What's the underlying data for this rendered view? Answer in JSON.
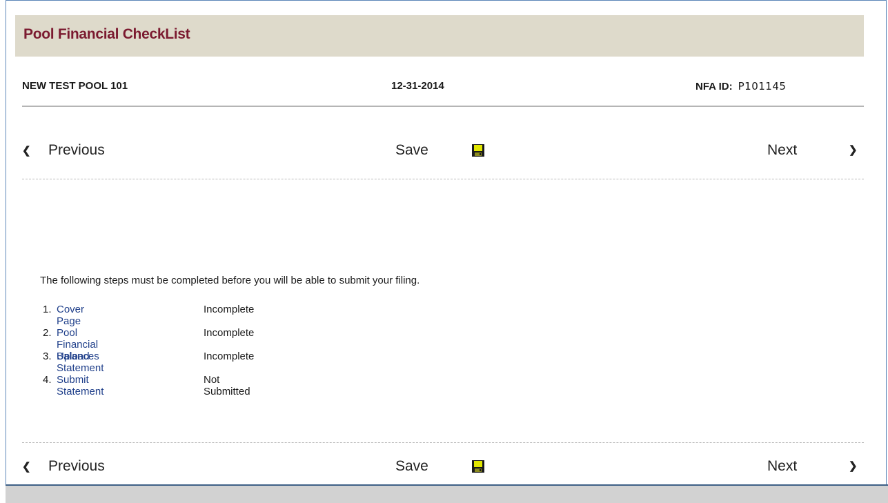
{
  "header": {
    "title": "Pool Financial CheckList"
  },
  "info": {
    "pool_name": "NEW TEST POOL 101",
    "period_date": "12-31-2014",
    "nfa_label": "NFA ID:",
    "nfa_value": "P101145"
  },
  "nav": {
    "previous_label": "Previous",
    "save_label": "Save",
    "next_label": "Next",
    "previous_icon": "chevron-left-icon",
    "save_icon": "floppy-disk-icon",
    "next_icon": "chevron-right-icon"
  },
  "content": {
    "intro": "The following steps must be completed before you will be able to submit your filing.",
    "steps": [
      {
        "num": "1.",
        "label": "Cover Page",
        "status": "Incomplete"
      },
      {
        "num": "2.",
        "label": "Pool Financial Balances",
        "status": "Incomplete"
      },
      {
        "num": "3.",
        "label": "Upload Statement",
        "status": "Incomplete"
      },
      {
        "num": "4.",
        "label": "Submit Statement",
        "status": "Not Submitted"
      }
    ]
  },
  "colors": {
    "title_text": "#7b1a30",
    "title_bar": "#dedacb",
    "link": "#1f3f8a",
    "frame_border": "#5b86b8",
    "disk_icon": "#e1e600"
  }
}
